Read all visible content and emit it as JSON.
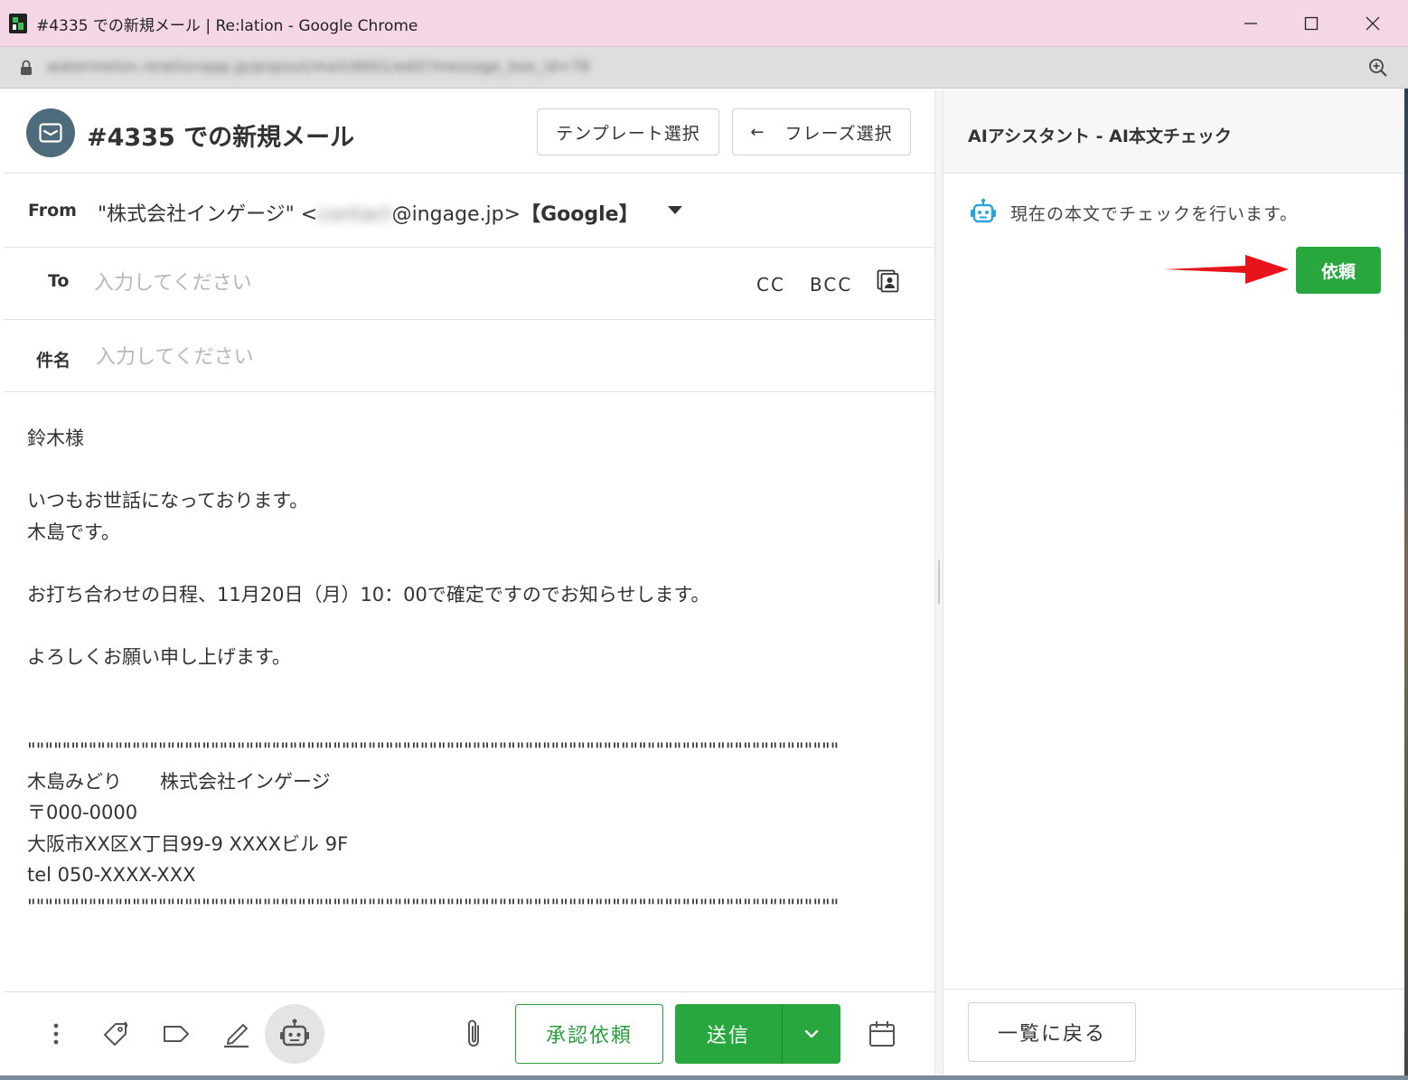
{
  "window": {
    "title": "#4335 での新規メール | Re:lation - Google Chrome"
  },
  "browser": {
    "url": "watermelon.relationapp.jp/popout/mail/4601/edit?message_box_id=78"
  },
  "compose": {
    "title": "#4335 での新規メール",
    "template_button": "テンプレート選択",
    "phrase_button_arrow": "←",
    "phrase_button": "フレーズ選択",
    "from": {
      "label": "From",
      "name_part": "\"株式会社インゲージ\" <",
      "local_part": "contact",
      "domain_part": "@ingage.jp>",
      "account": "【Google】"
    },
    "to": {
      "label": "To",
      "placeholder": "入力してください",
      "cc": "CC",
      "bcc": "BCC"
    },
    "subject": {
      "label": "件名",
      "placeholder": "入力してください"
    },
    "body": "鈴木様\n\nいつもお世話になっております。\n木島です。\n\nお打ち合わせの日程、11月20日（月）10：00で確定ですのでお知らせします。\n\nよろしくお願い申し上げます。\n\n\n\"\"\"\"\"\"\"\"\"\"\"\"\"\"\"\"\"\"\"\"\"\"\"\"\"\"\"\"\"\"\"\"\"\"\"\"\"\"\"\"\"\"\"\"\"\"\"\"\"\"\"\"\"\"\"\"\"\"\"\"\"\"\"\"\"\"\"\"\"\"\"\"\"\"\"\"\"\"\"\"\"\"\"\"\"\"\"\"\"\"\"\"\"\n木島みどり　　株式会社インゲージ\n〒000-0000\n大阪市XX区X丁目99-9 XXXXビル 9F\ntel 050-XXXX-XXX\n\"\"\"\"\"\"\"\"\"\"\"\"\"\"\"\"\"\"\"\"\"\"\"\"\"\"\"\"\"\"\"\"\"\"\"\"\"\"\"\"\"\"\"\"\"\"\"\"\"\"\"\"\"\"\"\"\"\"\"\"\"\"\"\"\"\"\"\"\"\"\"\"\"\"\"\"\"\"\"\"\"\"\"\"\"\"\"\"\"\"\"\"\"",
    "approve_button": "承認依頼",
    "send_button": "送信"
  },
  "ai_panel": {
    "title": "AIアシスタント - AI本文チェック",
    "message": "現在の本文でチェックを行います。",
    "request_button": "依頼",
    "back_button": "一覧に戻る"
  },
  "colors": {
    "accent_green": "#28a73f",
    "titlebar_pink": "#f5d6e6",
    "avatar_slate": "#4e6b7b",
    "ai_icon_blue": "#2ba3e0",
    "arrow_red": "#e8141c"
  },
  "icons": {
    "titlebar": [
      "relation-app-icon",
      "minimize-icon",
      "maximize-icon",
      "close-icon"
    ],
    "address_bar": [
      "lock-icon",
      "zoom-icon"
    ],
    "header": [
      "mail-icon"
    ],
    "to_row": [
      "address-book-icon"
    ],
    "footer": [
      "more-vertical-icon",
      "tag-icon",
      "label-icon",
      "signature-pen-icon",
      "robot-icon",
      "paperclip-icon",
      "chevron-down-icon",
      "calendar-icon"
    ],
    "ai_panel": [
      "robot-icon",
      "red-arrow"
    ]
  }
}
